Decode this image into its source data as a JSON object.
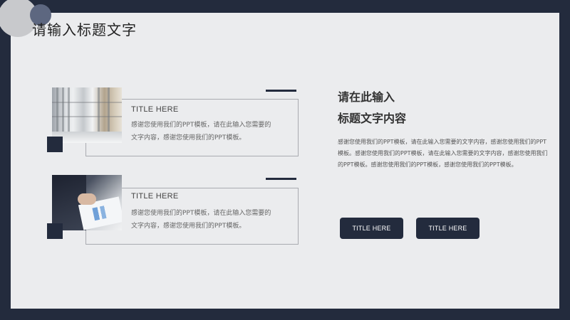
{
  "slide": {
    "title": "请输入标题文字",
    "colors": {
      "navy": "#232b3d",
      "background": "#ebecee",
      "border": "#a9abb0"
    }
  },
  "cards": [
    {
      "title": "TITLE HERE",
      "text_line1": "感谢您使用我们的PPT模板，请在此输入您需要的",
      "text_line2": "文字内容，感谢您使用我们的PPT模板。",
      "image": "office-interior-photo"
    },
    {
      "title": "TITLE HERE",
      "text_line1": "感谢您使用我们的PPT模板，请在此输入您需要的",
      "text_line2": "文字内容，感谢您使用我们的PPT模板。",
      "image": "business-meeting-photo"
    }
  ],
  "right_panel": {
    "heading_line1": "请在此输入",
    "heading_line2": "标题文字内容",
    "paragraph": "感谢您使用我们的PPT模板，请在此输入您需要的文字内容，感谢您使用我们的PPT模板。感谢您使用我们的PPT模板，请在此输入您需要的文字内容，感谢您使用我们的PPT模板。感谢您使用我们的PPT模板，感谢您使用我们的PPT模板。"
  },
  "buttons": [
    {
      "label": "TITLE HERE"
    },
    {
      "label": "TITLE HERE"
    }
  ]
}
